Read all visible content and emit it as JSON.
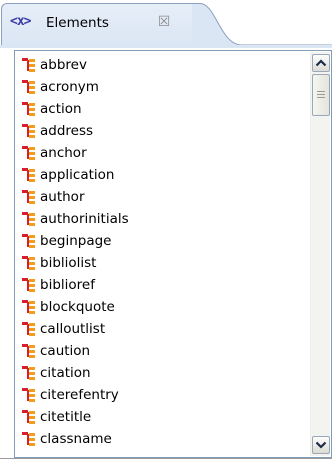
{
  "tab": {
    "icon_text": "<x>",
    "title": "Elements",
    "close_symbol": "☒"
  },
  "elements": [
    "abbrev",
    "acronym",
    "action",
    "address",
    "anchor",
    "application",
    "author",
    "authorinitials",
    "beginpage",
    "bibliolist",
    "biblioref",
    "blockquote",
    "calloutlist",
    "caution",
    "citation",
    "citerefentry",
    "citetitle",
    "classname"
  ],
  "colors": {
    "tab_background": "#dbe6f4",
    "list_border": "#7f9db9",
    "element_icon_red": "#d81e2a",
    "element_icon_orange": "#f29d1e"
  },
  "icons": {
    "element": "element-icon",
    "scroll_up": "arrow-up-icon",
    "scroll_down": "arrow-down-icon"
  }
}
